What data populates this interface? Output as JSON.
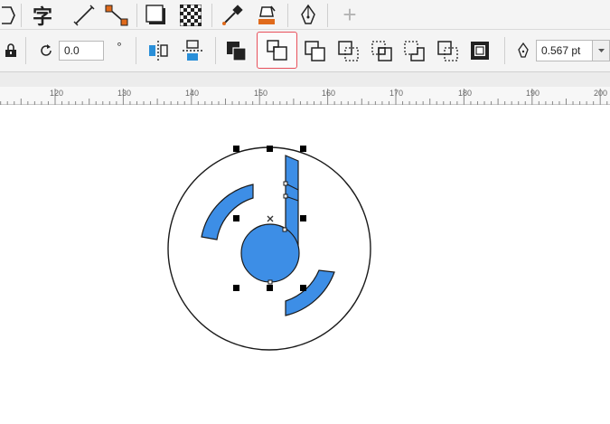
{
  "toolbar_top": {
    "text_tool_glyph": "字",
    "add_glyph": "+"
  },
  "property_bar": {
    "rotation_value": "0.0",
    "degree_symbol": "°",
    "outline_width_value": "0.567 pt"
  },
  "ruler": {
    "tick_labels": [
      "120",
      "130",
      "140",
      "150",
      "160",
      "170",
      "180",
      "190",
      "200"
    ]
  },
  "colors": {
    "shape_fill": "#3d8ee6",
    "outline": "#1a1a1a",
    "highlight": "#e8505b",
    "accent_orange": "#e06a1b",
    "accent_blue": "#2a8fd8"
  }
}
